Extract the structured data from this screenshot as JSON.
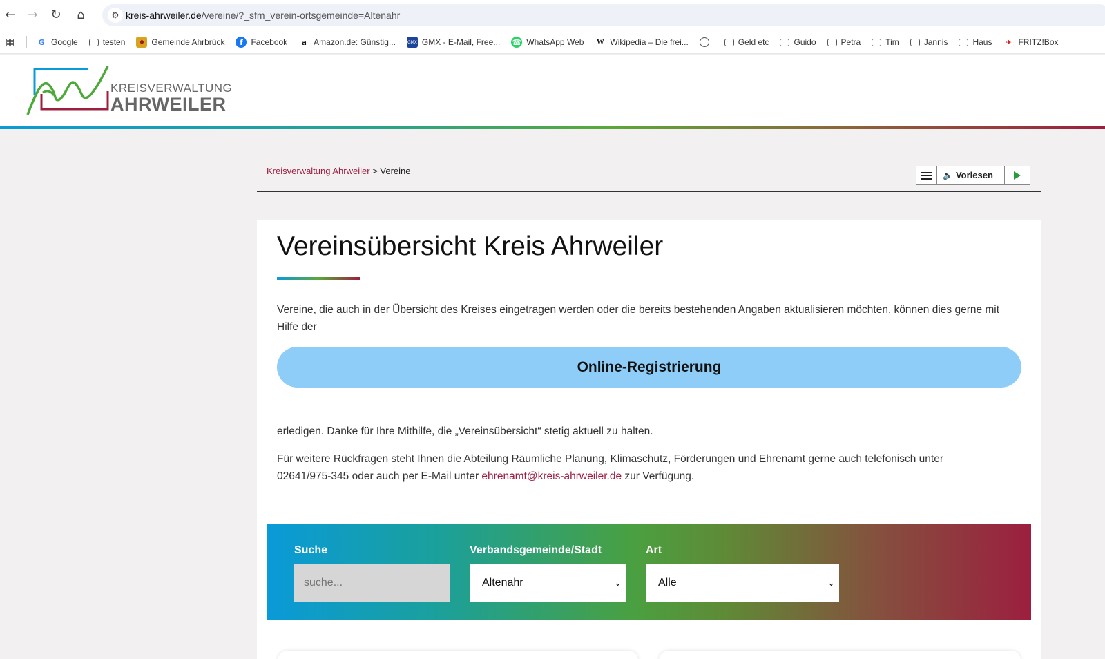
{
  "browser": {
    "url_domain": "kreis-ahrweiler.de",
    "url_path": "/vereine/?_sfm_verein-ortsgemeinde=Altenahr",
    "bookmarks": [
      {
        "label": "Google",
        "icon": "google-icon"
      },
      {
        "label": "testen",
        "icon": "folder-icon"
      },
      {
        "label": "Gemeinde Ahrbrück",
        "icon": "crest-icon"
      },
      {
        "label": "Facebook",
        "icon": "facebook-icon"
      },
      {
        "label": "Amazon.de: Günstig...",
        "icon": "amazon-icon"
      },
      {
        "label": "GMX - E-Mail, Free...",
        "icon": "gmx-icon"
      },
      {
        "label": "WhatsApp Web",
        "icon": "whatsapp-icon"
      },
      {
        "label": "Wikipedia – Die frei...",
        "icon": "wikipedia-icon"
      },
      {
        "label": "",
        "icon": "globe-icon"
      },
      {
        "label": "Geld etc",
        "icon": "folder-icon"
      },
      {
        "label": "Guido",
        "icon": "folder-icon"
      },
      {
        "label": "Petra",
        "icon": "folder-icon"
      },
      {
        "label": "Tim",
        "icon": "folder-icon"
      },
      {
        "label": "Jannis",
        "icon": "folder-icon"
      },
      {
        "label": "Haus",
        "icon": "folder-icon"
      },
      {
        "label": "FRITZ!Box",
        "icon": "fritzbox-icon"
      }
    ]
  },
  "header": {
    "logo_line1": "KREISVERWALTUNG",
    "logo_line2": "AHRWEILER"
  },
  "breadcrumb": {
    "home": "Kreisverwaltung Ahrweiler",
    "separator": " > ",
    "current": "Vereine"
  },
  "reader": {
    "label": "Vorlesen"
  },
  "content": {
    "title": "Vereinsübersicht Kreis Ahrweiler",
    "intro": "Vereine, die auch in der Übersicht des Kreises eingetragen werden oder die bereits bestehenden Angaben aktualisieren möchten, können dies gerne mit Hilfe der",
    "register_button": "Online-Registrierung",
    "thanks": "erledigen. Danke für Ihre Mithilfe, die „Vereinsübersicht“ stetig aktuell zu halten.",
    "contact_text_before": "Für weitere Rückfragen steht Ihnen die Abteilung Räumliche Planung, Klimaschutz, Förderungen und Ehrenamt gerne auch telefonisch unter 02641/975-345 oder auch per E-Mail unter ",
    "contact_email": "ehrenamt@kreis-ahrweiler.de",
    "contact_text_after": " zur Verfügung."
  },
  "filters": {
    "search_label": "Suche",
    "search_placeholder": "suche...",
    "vg_label": "Verbandsgemeinde/Stadt",
    "vg_value": "Altenahr",
    "art_label": "Art",
    "art_value": "Alle"
  },
  "colors": {
    "accent_red": "#9c1f3f",
    "button_blue": "#8ecdf8",
    "gradient_start": "#0b9bd6",
    "gradient_mid": "#5aa83a",
    "gradient_end": "#9c1f3f"
  }
}
